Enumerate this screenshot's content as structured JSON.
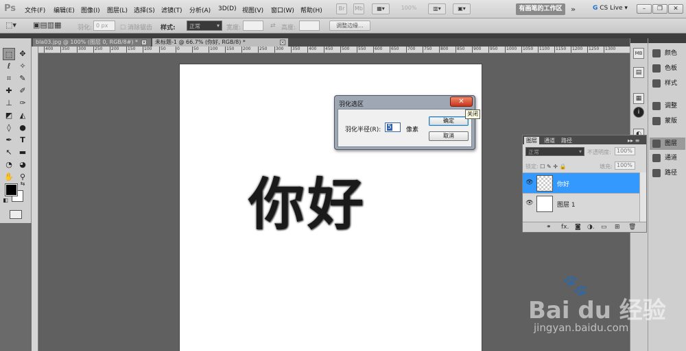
{
  "app": {
    "logo": "Ps",
    "menu": [
      "文件(F)",
      "编辑(E)",
      "图像(I)",
      "图层(L)",
      "选择(S)",
      "滤镜(T)",
      "分析(A)",
      "3D(D)",
      "视图(V)",
      "窗口(W)",
      "帮助(H)"
    ],
    "bridge_label": "Br",
    "minibridge_label": "Mb",
    "zoom_level": "100%",
    "workspace_button": "有画笔的工作区",
    "cs_live": "CS Live",
    "win_min": "–",
    "win_restore": "❐",
    "win_close": "✕"
  },
  "options_bar": {
    "feather_label": "羽化:",
    "feather_value": "0 px",
    "antialias_label": "消除锯齿",
    "style_label": "样式:",
    "style_value": "正常",
    "width_label": "宽度:",
    "height_label": "高度:",
    "refine_edge": "调整边缘..."
  },
  "tabs": [
    {
      "label": "bla03.jpg @ 100% (图层 0, RGB/8#) *",
      "close": "×"
    },
    {
      "label": "未标题-1 @ 66.7% (你好, RGB/8) *",
      "close": "×"
    }
  ],
  "ruler_ticks": [
    "400",
    "350",
    "300",
    "250",
    "200",
    "150",
    "100",
    "50",
    "0",
    "50",
    "100",
    "150",
    "200",
    "250",
    "300",
    "350",
    "400",
    "450",
    "500",
    "550",
    "600",
    "650",
    "700",
    "750",
    "800",
    "850",
    "900",
    "950",
    "1000",
    "1050",
    "1100",
    "1150",
    "1200",
    "1250",
    "1300"
  ],
  "canvas": {
    "text": "你好"
  },
  "dialog": {
    "title": "羽化选区",
    "close_icon": "✕",
    "radius_label": "羽化半径(R):",
    "radius_value": "5",
    "unit": "像素",
    "ok": "确定",
    "cancel": "取消",
    "tooltip": "关闭"
  },
  "right_panels": {
    "items": [
      {
        "label": "颜色",
        "active": false
      },
      {
        "label": "色板",
        "active": false
      },
      {
        "label": "样式",
        "active": false
      },
      {
        "label": "调整",
        "active": false
      },
      {
        "label": "蒙版",
        "active": false
      },
      {
        "label": "图层",
        "active": true
      },
      {
        "label": "通道",
        "active": false
      },
      {
        "label": "路径",
        "active": false
      }
    ],
    "mini_icons": [
      "MB",
      "▤",
      "▦",
      "◐",
      "❖"
    ]
  },
  "layers_panel": {
    "tabs": [
      "图层",
      "通道",
      "路径"
    ],
    "menu_icon": "▸▸ ≡",
    "blend_mode": "正常",
    "opacity_label": "不透明度:",
    "opacity_value": "100%",
    "lock_label": "锁定:",
    "lock_icons": "☐ ✎ ✛ 🔒",
    "fill_label": "填充:",
    "fill_value": "100%",
    "layers": [
      {
        "name": "你好",
        "selected": true,
        "eye": "👁"
      },
      {
        "name": "图层 1",
        "selected": false,
        "eye": "👁"
      }
    ],
    "footer_icons": [
      "⚭",
      "fx.",
      "◙",
      "◑.",
      "▭",
      "⊞",
      "🗑"
    ]
  },
  "watermark": {
    "paw": "🐾",
    "brand": "Bai du 经验",
    "url": "jingyan.baidu.com"
  },
  "colors": {
    "selection_blue": "#3399ff",
    "close_red": "#c8341a",
    "dialog_frame": "#9ea7b3"
  }
}
